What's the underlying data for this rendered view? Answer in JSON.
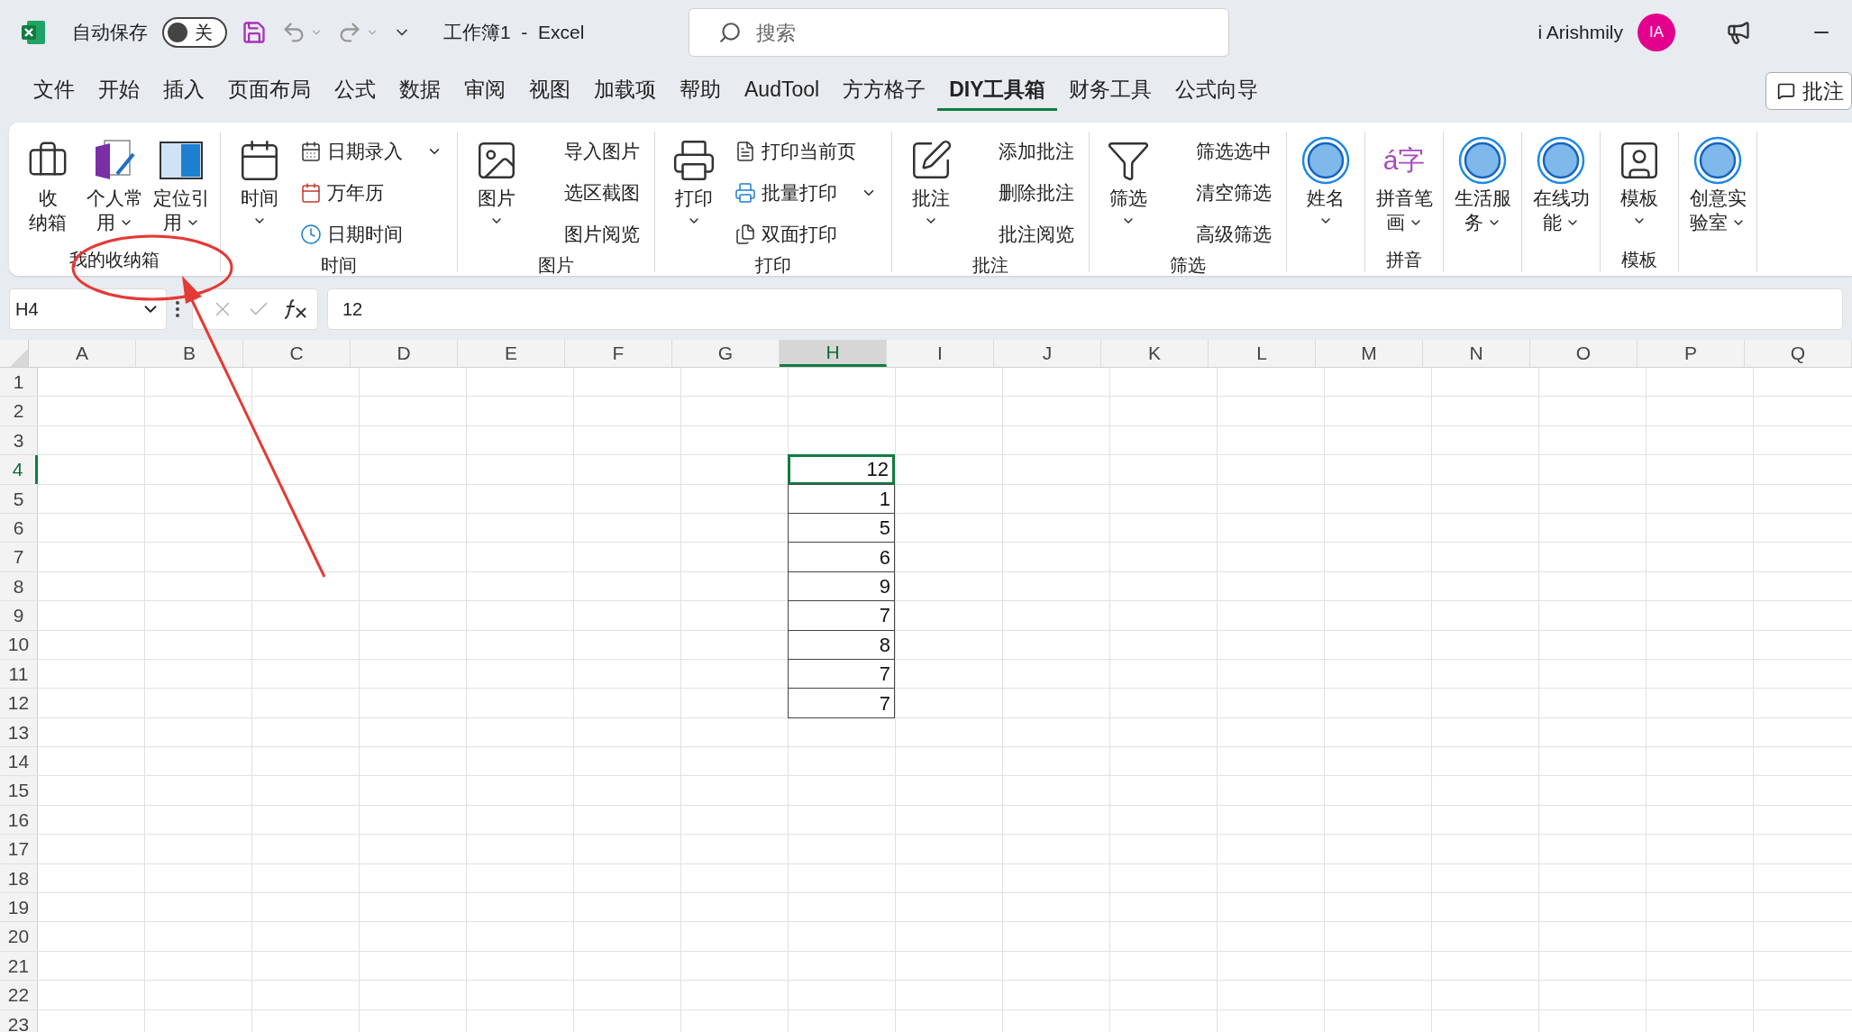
{
  "title_bar": {
    "autosave_label": "自动保存",
    "autosave_toggle": {
      "label": "关",
      "on": false
    },
    "title": "工作簿1  -  Excel",
    "search": {
      "placeholder": "搜索"
    },
    "user_name": "i Arishmily",
    "avatar": "IA"
  },
  "menu_tabs": [
    {
      "label": "文件",
      "selected": false
    },
    {
      "label": "开始",
      "selected": false
    },
    {
      "label": "插入",
      "selected": false
    },
    {
      "label": "页面布局",
      "selected": false
    },
    {
      "label": "公式",
      "selected": false
    },
    {
      "label": "数据",
      "selected": false
    },
    {
      "label": "审阅",
      "selected": false
    },
    {
      "label": "视图",
      "selected": false
    },
    {
      "label": "加载项",
      "selected": false
    },
    {
      "label": "帮助",
      "selected": false
    },
    {
      "label": "AudTool",
      "selected": false
    },
    {
      "label": "方方格子",
      "selected": false
    },
    {
      "label": "DIY工具箱",
      "selected": true
    },
    {
      "label": "财务工具",
      "selected": false
    },
    {
      "label": "公式向导",
      "selected": false
    }
  ],
  "comment_button": "批注",
  "ribbon_groups": [
    {
      "label": "我的收纳箱",
      "large": [
        {
          "lines": [
            "收",
            "纳箱"
          ],
          "dropdown": false
        },
        {
          "lines": [
            "个人常",
            "用"
          ],
          "dropdown": true
        },
        {
          "lines": [
            "定位引",
            "用"
          ],
          "dropdown": true
        }
      ]
    },
    {
      "label": "时间",
      "large": [
        {
          "lines": [
            "时间"
          ],
          "dropdown": true
        }
      ],
      "small": [
        {
          "label": "日期录入",
          "dropdown": true
        },
        {
          "label": "万年历",
          "dropdown": false
        },
        {
          "label": "日期时间",
          "dropdown": false
        }
      ]
    },
    {
      "label": "图片",
      "large": [
        {
          "lines": [
            "图片"
          ],
          "dropdown": true
        }
      ],
      "small": [
        {
          "label": "导入图片",
          "dropdown": false
        },
        {
          "label": "选区截图",
          "dropdown": false
        },
        {
          "label": "图片阅览",
          "dropdown": false
        }
      ]
    },
    {
      "label": "打印",
      "large": [
        {
          "lines": [
            "打印"
          ],
          "dropdown": true
        }
      ],
      "small": [
        {
          "label": "打印当前页",
          "dropdown": false
        },
        {
          "label": "批量打印",
          "dropdown": true
        },
        {
          "label": "双面打印",
          "dropdown": false
        }
      ]
    },
    {
      "label": "批注",
      "large": [
        {
          "lines": [
            "批注"
          ],
          "dropdown": true
        }
      ],
      "small": [
        {
          "label": "添加批注",
          "dropdown": false
        },
        {
          "label": "删除批注",
          "dropdown": false
        },
        {
          "label": "批注阅览",
          "dropdown": false
        }
      ]
    },
    {
      "label": "筛选",
      "large": [
        {
          "lines": [
            "筛选"
          ],
          "dropdown": true
        }
      ],
      "small": [
        {
          "label": "筛选选中",
          "dropdown": false
        },
        {
          "label": "清空筛选",
          "dropdown": false
        },
        {
          "label": "高级筛选",
          "dropdown": false
        }
      ]
    },
    {
      "large": [
        {
          "lines": [
            "姓名"
          ],
          "dropdown": true
        }
      ]
    },
    {
      "label": "拼音",
      "large": [
        {
          "lines": [
            "拼音笔",
            "画"
          ],
          "dropdown": true,
          "icon_glyph": "á字"
        }
      ]
    },
    {
      "large": [
        {
          "lines": [
            "生活服",
            "务"
          ],
          "dropdown": true
        }
      ]
    },
    {
      "large": [
        {
          "lines": [
            "在线功",
            "能"
          ],
          "dropdown": true
        }
      ]
    },
    {
      "label": "模板",
      "large": [
        {
          "lines": [
            "模板"
          ],
          "dropdown": true
        }
      ]
    },
    {
      "large": [
        {
          "lines": [
            "创意实",
            "验室"
          ],
          "dropdown": true
        }
      ]
    }
  ],
  "formula_bar": {
    "name_box": "H4",
    "formula": "12"
  },
  "sheet": {
    "columns": [
      {
        "label": "A",
        "selected": false
      },
      {
        "label": "B",
        "selected": false
      },
      {
        "label": "C",
        "selected": false
      },
      {
        "label": "D",
        "selected": false
      },
      {
        "label": "E",
        "selected": false
      },
      {
        "label": "F",
        "selected": false
      },
      {
        "label": "G",
        "selected": false
      },
      {
        "label": "H",
        "selected": true
      },
      {
        "label": "I",
        "selected": false
      },
      {
        "label": "J",
        "selected": false
      },
      {
        "label": "K",
        "selected": false
      },
      {
        "label": "L",
        "selected": false
      },
      {
        "label": "M",
        "selected": false
      },
      {
        "label": "N",
        "selected": false
      },
      {
        "label": "O",
        "selected": false
      },
      {
        "label": "P",
        "selected": false
      },
      {
        "label": "Q",
        "selected": false
      }
    ],
    "rows": [
      {
        "header": "1",
        "selected": false
      },
      {
        "header": "2",
        "selected": false
      },
      {
        "header": "3",
        "selected": false
      },
      {
        "header": "4",
        "selected": true,
        "cells": [
          null,
          null,
          null,
          null,
          null,
          null,
          null,
          "12"
        ]
      },
      {
        "header": "5",
        "selected": false,
        "cells": [
          null,
          null,
          null,
          null,
          null,
          null,
          null,
          "1"
        ]
      },
      {
        "header": "6",
        "selected": false,
        "cells": [
          null,
          null,
          null,
          null,
          null,
          null,
          null,
          "5"
        ]
      },
      {
        "header": "7",
        "selected": false,
        "cells": [
          null,
          null,
          null,
          null,
          null,
          null,
          null,
          "6"
        ]
      },
      {
        "header": "8",
        "selected": false,
        "cells": [
          null,
          null,
          null,
          null,
          null,
          null,
          null,
          "9"
        ]
      },
      {
        "header": "9",
        "selected": false,
        "cells": [
          null,
          null,
          null,
          null,
          null,
          null,
          null,
          "7"
        ]
      },
      {
        "header": "10",
        "selected": false,
        "cells": [
          null,
          null,
          null,
          null,
          null,
          null,
          null,
          "8"
        ]
      },
      {
        "header": "11",
        "selected": false,
        "cells": [
          null,
          null,
          null,
          null,
          null,
          null,
          null,
          "7"
        ]
      },
      {
        "header": "12",
        "selected": false,
        "cells": [
          null,
          null,
          null,
          null,
          null,
          null,
          null,
          "7"
        ]
      },
      {
        "header": "13",
        "selected": false
      },
      {
        "header": "14",
        "selected": false
      },
      {
        "header": "15",
        "selected": false
      },
      {
        "header": "16",
        "selected": false
      },
      {
        "header": "17",
        "selected": false
      },
      {
        "header": "18",
        "selected": false
      },
      {
        "header": "19",
        "selected": false
      },
      {
        "header": "20",
        "selected": false
      },
      {
        "header": "21",
        "selected": false
      },
      {
        "header": "22",
        "selected": false
      },
      {
        "header": "23",
        "selected": false
      }
    ]
  }
}
